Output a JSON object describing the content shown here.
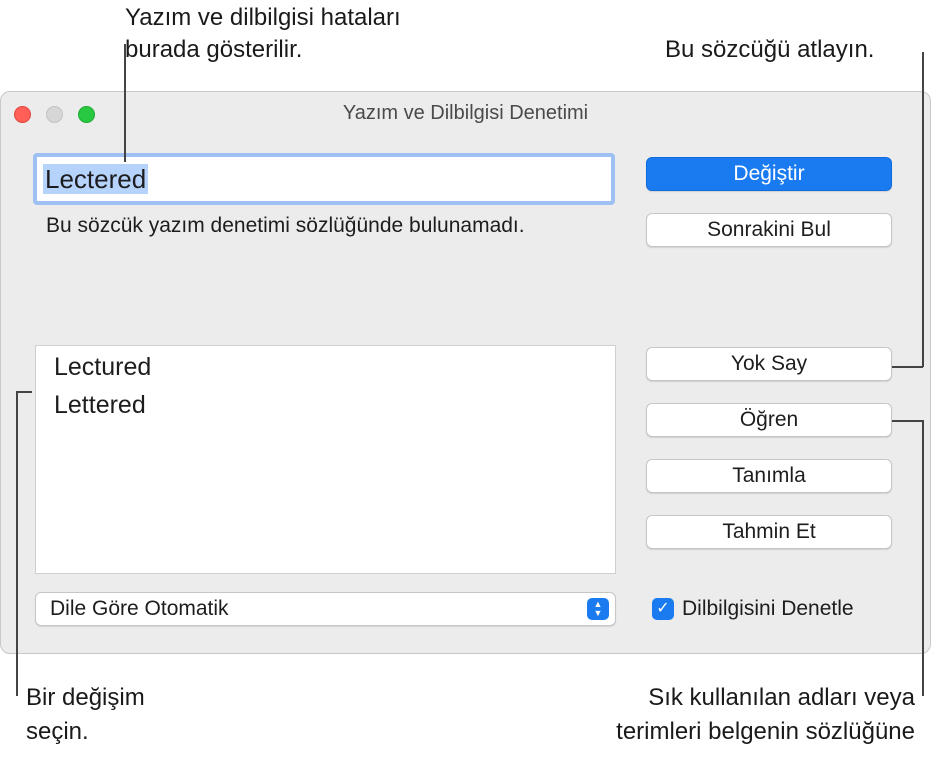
{
  "callouts": {
    "errors_line1": "Yazım ve dilbilgisi hataları",
    "errors_line2": "burada gösterilir.",
    "ignore": "Bu sözcüğü atlayın.",
    "choose_line1": "Bir değişim",
    "choose_line2": "seçin.",
    "learn_line1": "Sık kullanılan adları veya",
    "learn_line2": "terimleri belgenin sözlüğüne"
  },
  "window": {
    "title": "Yazım ve Dilbilgisi Denetimi",
    "misspelled_word": "Lectered",
    "message": "Bu sözcük yazım denetimi sözlüğünde bulunamadı.",
    "suggestions": [
      "Lectured",
      "Lettered"
    ],
    "buttons": {
      "change": "Değiştir",
      "find_next": "Sonrakini Bul",
      "ignore": "Yok Say",
      "learn": "Öğren",
      "define": "Tanımla",
      "guess": "Tahmin Et"
    },
    "language_select": "Dile Göre Otomatik",
    "grammar_check_label": "Dilbilgisini Denetle",
    "grammar_check_checked": true
  },
  "colors": {
    "accent": "#1a7bf1",
    "close": "#ff5f57",
    "maximize": "#28c840"
  }
}
